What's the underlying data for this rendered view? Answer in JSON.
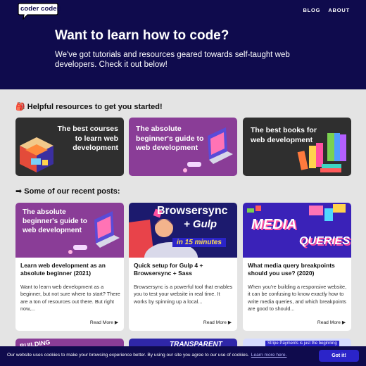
{
  "header": {
    "logo_text": "coder coder!",
    "nav": [
      "BLOG",
      "ABOUT"
    ]
  },
  "hero": {
    "title": "Want to learn how to code?",
    "subtitle": "We've got tutorials and resources geared towards self-taught web developers. Check it out below!"
  },
  "resources": {
    "heading": "🎒 Helpful resources to get you started!",
    "cards": [
      {
        "title": "The best courses to learn web development"
      },
      {
        "title": "The absolute beginner's guide to web development"
      },
      {
        "title": "The best books for web development"
      }
    ]
  },
  "posts": {
    "heading": "➡ Some of our recent posts:",
    "read_more": "Read More ▶",
    "items": [
      {
        "thumb_text": "The absolute beginner's guide to web development",
        "title": "Learn web development as an absolute beginner (2021)",
        "excerpt": "Want to learn web development as a beginner, but not sure where to start? There are a ton of resources out there. But right now,..."
      },
      {
        "thumb_brand": "Browsersync",
        "thumb_sub": "+ Gulp",
        "thumb_badge": "in 15 minutes",
        "title": "Quick setup for Gulp 4 + Browsersync + Sass",
        "excerpt": "Browsersync is a powerful tool that enables you to test your website in real time. It works by spinning up a local..."
      },
      {
        "thumb_word1": "MEDIA",
        "thumb_word2": "QUERIES",
        "title": "What media query breakpoints should you use? (2020)",
        "excerpt": "When you're building a responsive website, it can be confusing to know exactly how to write media queries, and which breakpoints are good to should..."
      }
    ],
    "peek": [
      {
        "text": "BUILDING"
      },
      {
        "text": "TRANSPARENT"
      },
      {
        "text": "Stripe Payments is just the beginning"
      }
    ]
  },
  "cookie": {
    "message": "Our website uses cookies to make your browsing experience better. By using our site you agree to our use of cookies.",
    "link": "Learn more here.",
    "button": "Got it!"
  },
  "colors": {
    "navy": "#0f0b4d",
    "dark_card": "#2f2f2f",
    "purple_card": "#8a3d97",
    "button_blue": "#2b24c9"
  }
}
